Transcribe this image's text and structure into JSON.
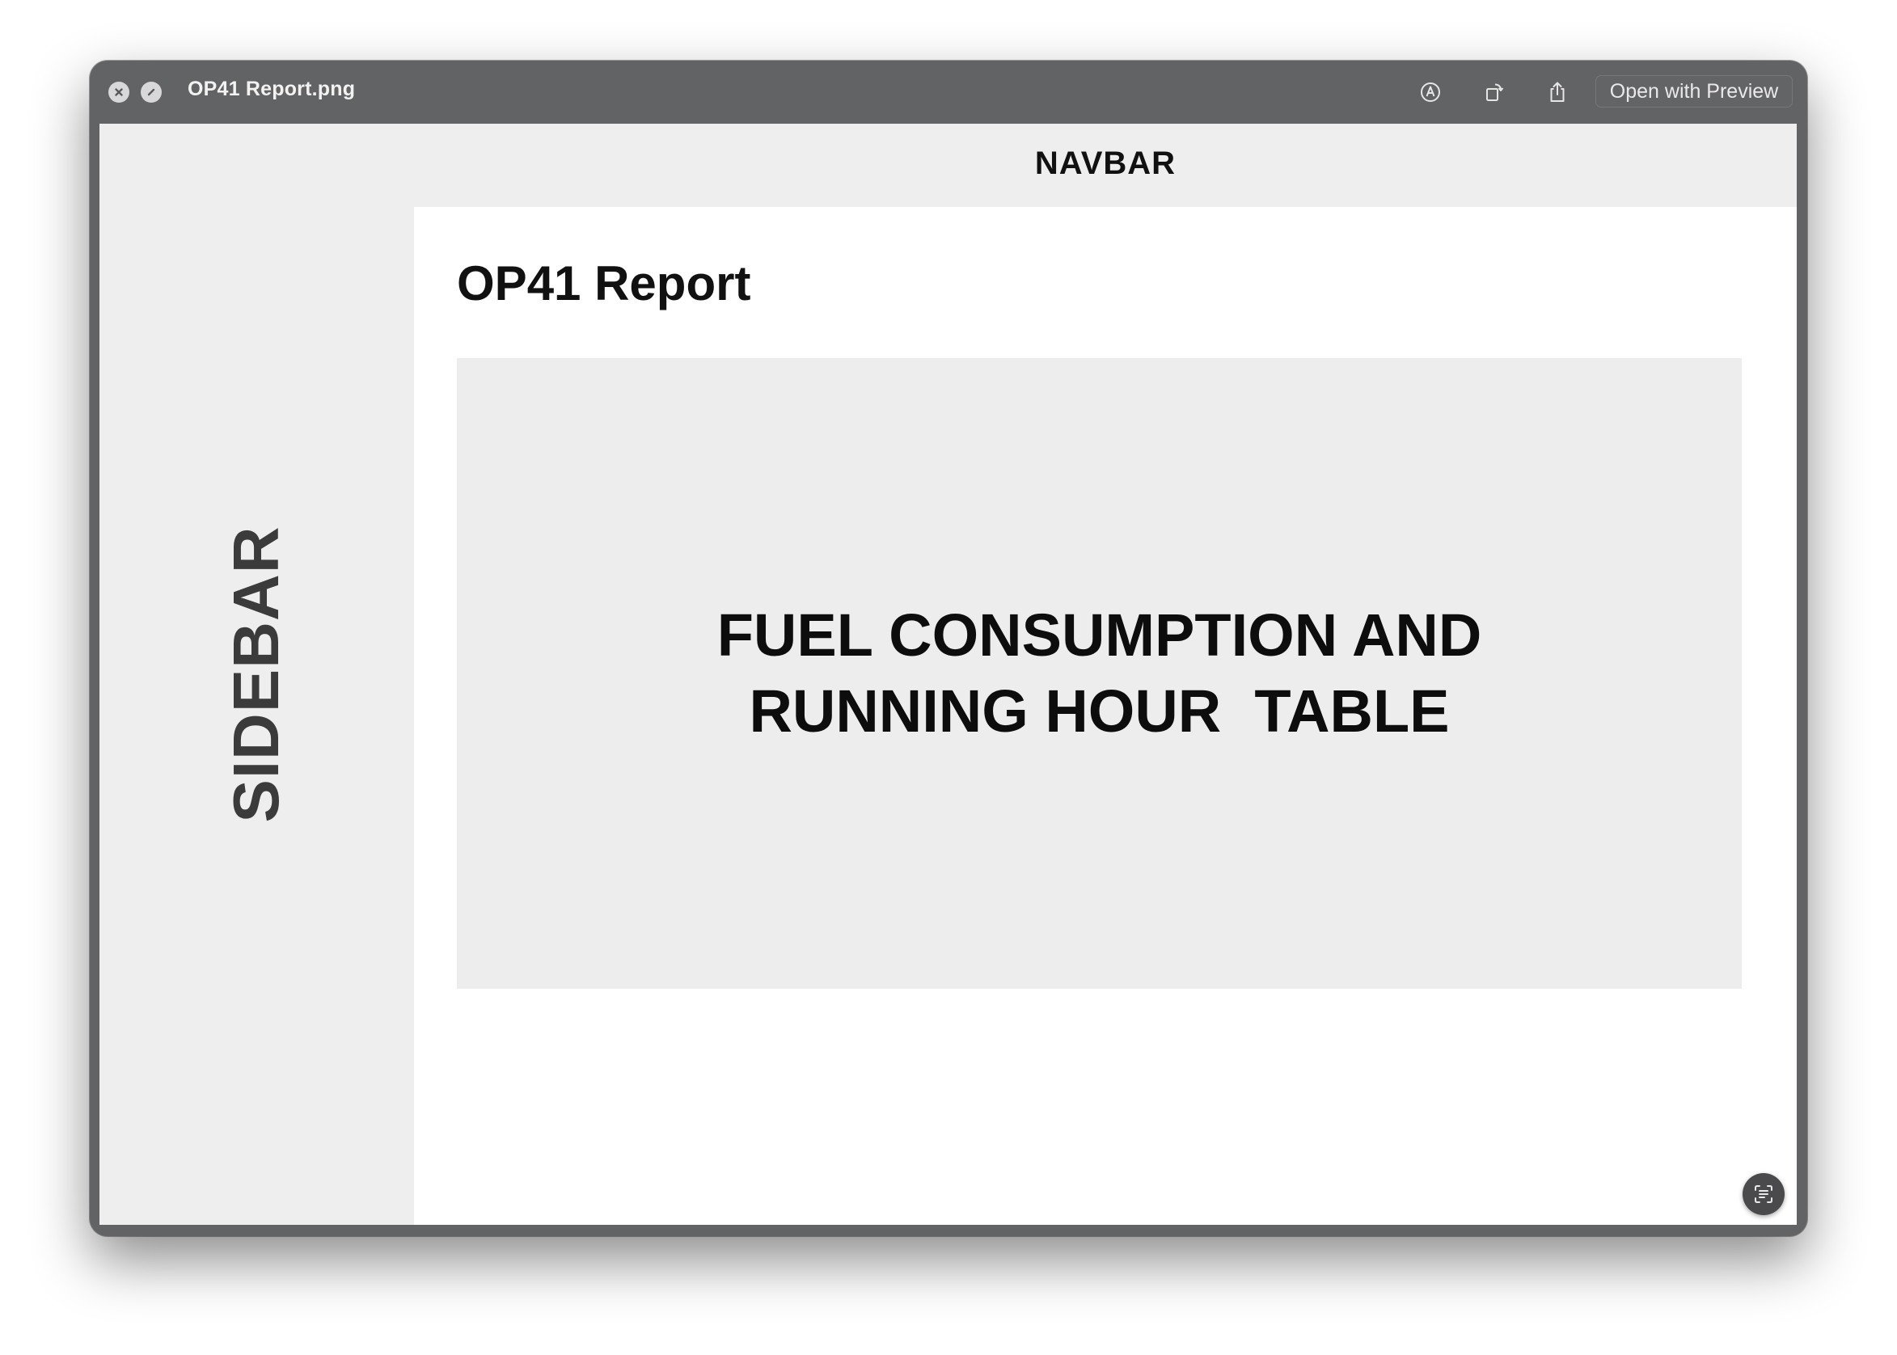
{
  "window": {
    "title": "OP41 Report.png",
    "open_with_label": "Open with Preview"
  },
  "icons": {
    "close": "close-icon",
    "disable": "disabled-icon",
    "markup": "markup-icon",
    "rotate": "rotate-icon",
    "share": "share-icon",
    "live_text": "live-text-icon"
  },
  "layout_labels": {
    "sidebar": "SIDEBAR",
    "navbar": "NAVBAR"
  },
  "page": {
    "title": "OP41 Report",
    "panel_text": "FUEL CONSUMPTION AND\nRUNNING HOUR  TABLE"
  },
  "colors": {
    "titlebar": "#626365",
    "wireframe_gray": "#eeeeee",
    "main_background": "#ffffff"
  }
}
